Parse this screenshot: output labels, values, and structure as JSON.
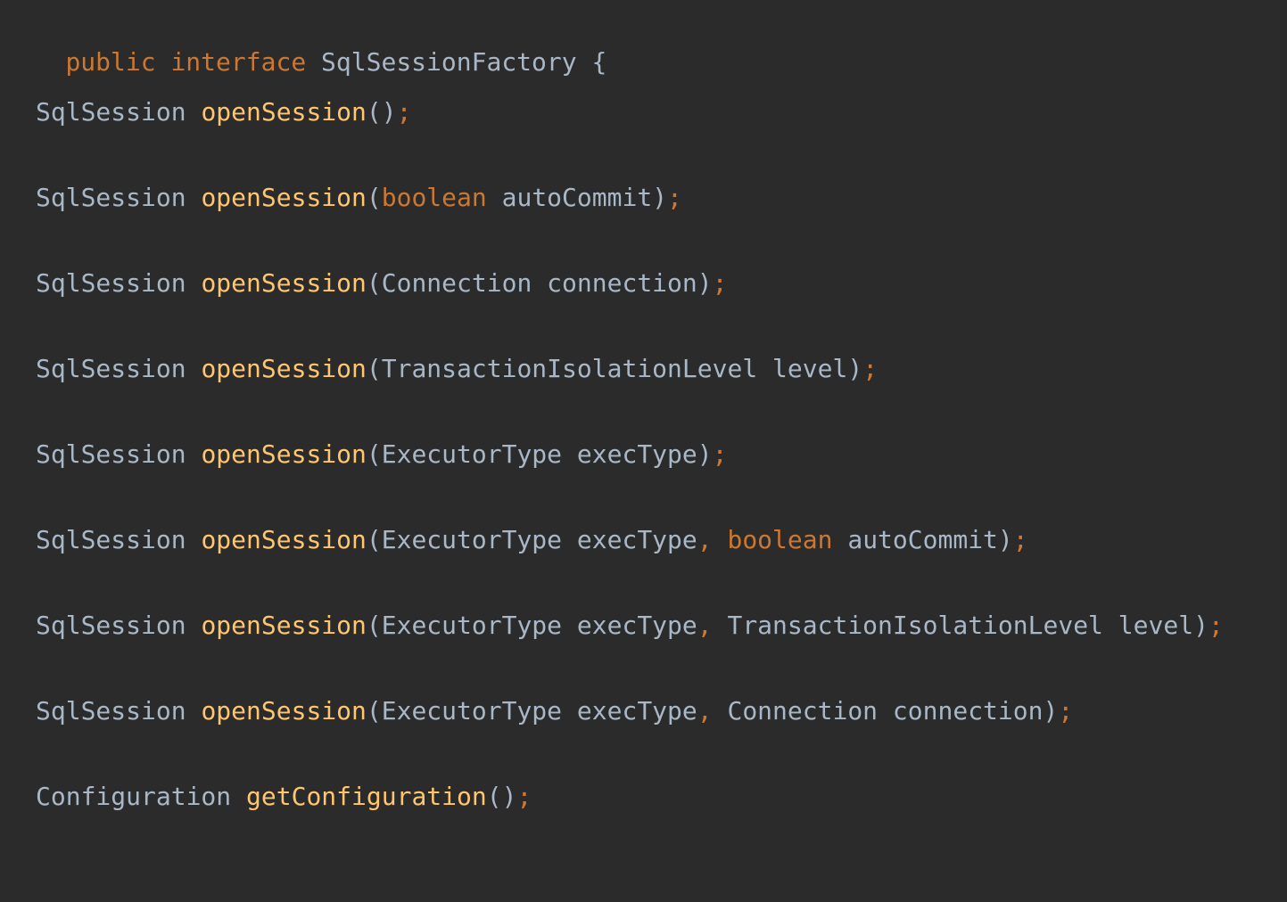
{
  "editor": {
    "header": {
      "kw_public": "public",
      "kw_interface": "interface",
      "name": "SqlSessionFactory",
      "brace_open": "{"
    },
    "methods": [
      {
        "ret": "SqlSession",
        "name": "openSession",
        "open": "(",
        "params": [],
        "close": ")",
        "semi": ";"
      },
      {
        "ret": "SqlSession",
        "name": "openSession",
        "open": "(",
        "params": [
          {
            "type": "boolean",
            "name": "autoCommit",
            "primitive": true
          }
        ],
        "close": ")",
        "semi": ";"
      },
      {
        "ret": "SqlSession",
        "name": "openSession",
        "open": "(",
        "params": [
          {
            "type": "Connection",
            "name": "connection",
            "primitive": false
          }
        ],
        "close": ")",
        "semi": ";"
      },
      {
        "ret": "SqlSession",
        "name": "openSession",
        "open": "(",
        "params": [
          {
            "type": "TransactionIsolationLevel",
            "name": "level",
            "primitive": false
          }
        ],
        "close": ")",
        "semi": ";"
      },
      {
        "ret": "SqlSession",
        "name": "openSession",
        "open": "(",
        "params": [
          {
            "type": "ExecutorType",
            "name": "execType",
            "primitive": false
          }
        ],
        "close": ")",
        "semi": ";"
      },
      {
        "ret": "SqlSession",
        "name": "openSession",
        "open": "(",
        "params": [
          {
            "type": "ExecutorType",
            "name": "execType",
            "primitive": false
          },
          {
            "type": "boolean",
            "name": "autoCommit",
            "primitive": true
          }
        ],
        "close": ")",
        "semi": ";"
      },
      {
        "ret": "SqlSession",
        "name": "openSession",
        "open": "(",
        "params": [
          {
            "type": "ExecutorType",
            "name": "execType",
            "primitive": false
          },
          {
            "type": "TransactionIsolationLevel",
            "name": "level",
            "primitive": false
          }
        ],
        "close": ")",
        "semi": ";"
      },
      {
        "ret": "SqlSession",
        "name": "openSession",
        "open": "(",
        "params": [
          {
            "type": "ExecutorType",
            "name": "execType",
            "primitive": false
          },
          {
            "type": "Connection",
            "name": "connection",
            "primitive": false
          }
        ],
        "close": ")",
        "semi": ";"
      },
      {
        "ret": "Configuration",
        "name": "getConfiguration",
        "open": "(",
        "params": [],
        "close": ")",
        "semi": ";"
      }
    ],
    "param_separator": ",",
    "brace_close": "}",
    "colors": {
      "background": "#2b2b2b",
      "keyword": "#cc7832",
      "method": "#ffc66d",
      "identifier": "#a9b7c6"
    }
  }
}
